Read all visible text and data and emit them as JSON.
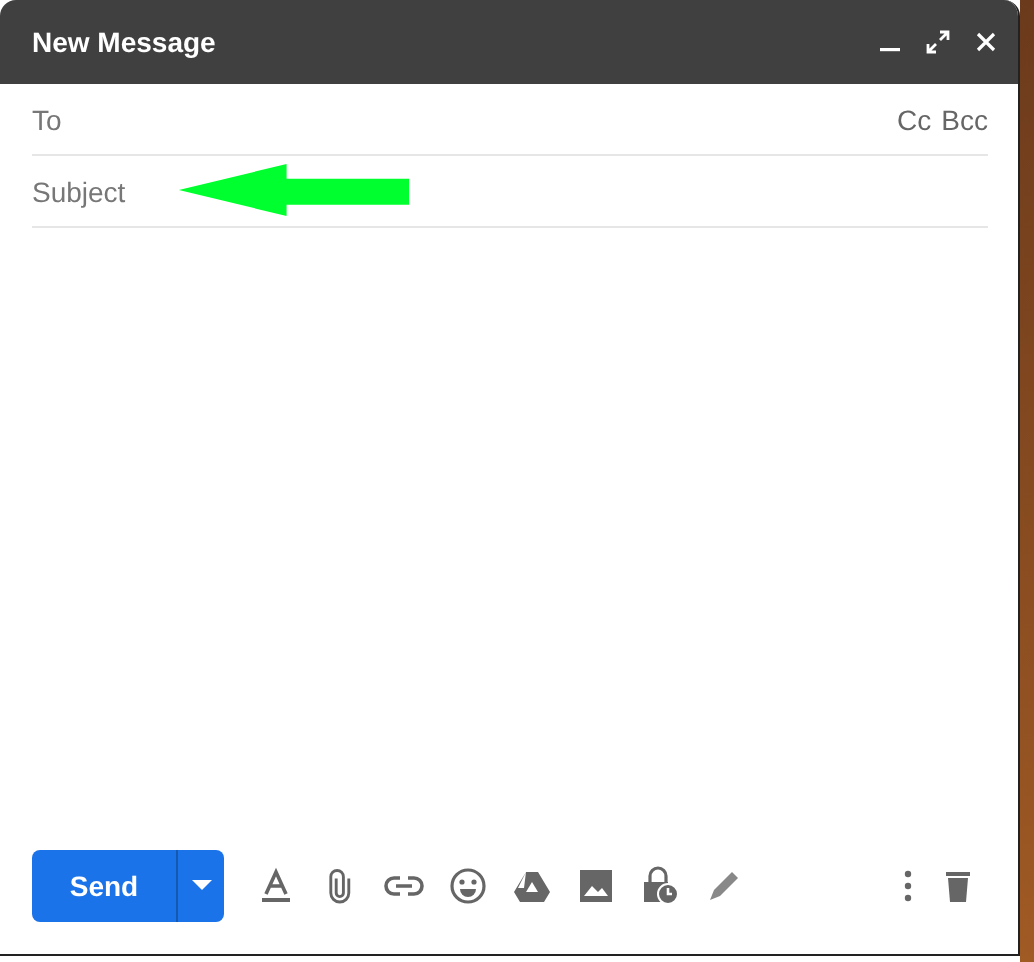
{
  "window": {
    "title": "New Message"
  },
  "to": {
    "label": "To",
    "links": [
      "Cc",
      "Bcc"
    ]
  },
  "subject": {
    "placeholder": "Subject"
  },
  "send": {
    "label": "Send"
  }
}
